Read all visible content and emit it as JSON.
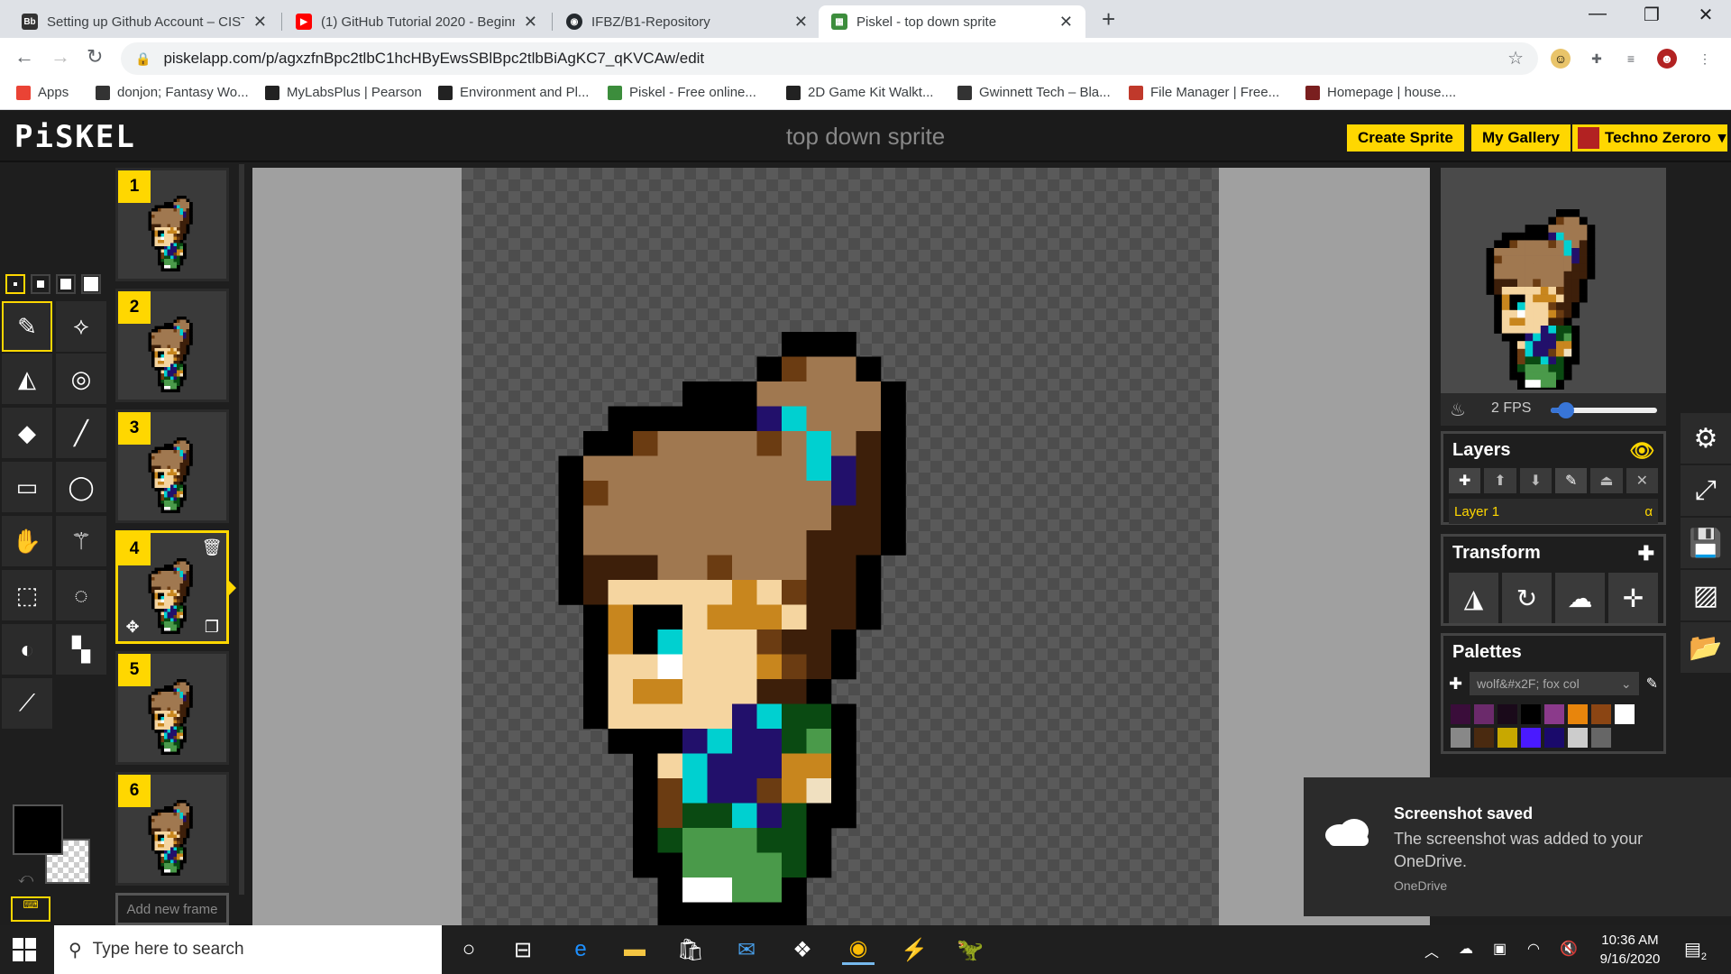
{
  "browser": {
    "tabs": [
      {
        "title": "Setting up Github Account – CIST",
        "favicon": "Bb",
        "color": "#333333"
      },
      {
        "title": "(1) GitHub Tutorial 2020 - Beginn",
        "favicon": "▶",
        "color": "#ff0000"
      },
      {
        "title": "IFBZ/B1-Repository",
        "favicon": "◉",
        "color": "#24292e"
      },
      {
        "title": "Piskel - top down sprite",
        "favicon": "▦",
        "color": "#3c8d3c"
      }
    ],
    "url": "piskelapp.com/p/agxzfnBpc2tlbC1hcHByEwsSBlBpc2tlbBiAgKC7_qKVCAw/edit",
    "bookmarks": [
      {
        "label": "Apps",
        "icon": "apps-icon",
        "color": "#ea4335"
      },
      {
        "label": "donjon; Fantasy Wo...",
        "icon": "donjon-icon",
        "color": "#333333"
      },
      {
        "label": "MyLabsPlus | Pearson",
        "icon": "pearson-icon",
        "color": "#222222"
      },
      {
        "label": "Environment and Pl...",
        "icon": "unity-icon",
        "color": "#222222"
      },
      {
        "label": "Piskel - Free online...",
        "icon": "piskel-icon",
        "color": "#3c8d3c"
      },
      {
        "label": "2D Game Kit Walkt...",
        "icon": "unity-icon",
        "color": "#222222"
      },
      {
        "label": "Gwinnett Tech – Bla...",
        "icon": "blackboard-icon",
        "color": "#333333"
      },
      {
        "label": "File Manager | Free...",
        "icon": "filemanager-icon",
        "color": "#c0392b"
      },
      {
        "label": "Homepage | house....",
        "icon": "house-icon",
        "color": "#7a1f1f"
      }
    ]
  },
  "piskel": {
    "logo": "PiSKEL",
    "title": "top down sprite",
    "create_sprite": "Create Sprite",
    "my_gallery": "My Gallery",
    "user": "Techno Zeroro",
    "frames": [
      "1",
      "2",
      "3",
      "4",
      "5",
      "6"
    ],
    "selected_frame": 4,
    "add_frame": "Add new frame",
    "fps_label": "2 FPS",
    "fps_value": 2,
    "fps_max": 24,
    "layers_title": "Layers",
    "layer_name": "Layer 1",
    "layer_alpha": "α",
    "transform_title": "Transform",
    "palettes_title": "Palettes",
    "palette_name": "wolf&#x2F; fox col",
    "palette_colors": [
      "#3a0d3a",
      "#6b2a6b",
      "#1a0a1a",
      "#000000",
      "#8b3a8b",
      "#e8850c",
      "#8b4513",
      "#ffffff",
      "#888888",
      "#4a2a10",
      "#c8a800",
      "#4a1aff",
      "#1a0a6b",
      "#cccccc",
      "#666666"
    ],
    "primary_color": "#000000"
  },
  "toast": {
    "title": "Screenshot saved",
    "body": "The screenshot was added to your OneDrive.",
    "source": "OneDrive"
  },
  "taskbar": {
    "search_placeholder": "Type here to search",
    "time": "10:36 AM",
    "date": "9/16/2020",
    "notification_count": "2"
  },
  "sprite": {
    "palette": {
      "K": "#000000",
      "H": "#a07850",
      "D": "#3d1f0a",
      "C": "#00d0d0",
      "P": "#22106b",
      "S": "#f5d5a0",
      "O": "#c8861e",
      "G": "#0a4a12",
      "L": "#4a9a4a",
      "W": "#ffffff",
      "B": "#6b3c12",
      "T": "#f0e0c0"
    },
    "rows": [
      "..........KKK.....",
      ".........KBHHK....",
      "......KKKHHHHHK...",
      "...KKKKKKPCHHHK...",
      "..KKBHHHHBHCHDK...",
      ".KHHHHHHHHHCPDK...",
      ".KBHHHHHHHHHPDK...",
      ".KHHHHHHHHHHDDK...",
      ".KHHHHHHHHHDDDK...",
      ".KDDDHHBHHHDDK....",
      ".KDSSSSSOSBDDK....",
      "..KOKKSOOOSDDK....",
      "..KOKCSSSBDDK.....",
      "..KSSWSSSOBDK.....",
      "..KSOOSSSDDK......",
      "..KSSSSSPCGGK.....",
      "...KKKPCPPGLK.....",
      "....KSCPPPOOK.....",
      "....KBCPPBOTK.....",
      "....KBGGCPGKK.....",
      "....KGLLLGGK......",
      "....KKLLLLGK......",
      ".....KWWLLK.......",
      ".....KKKKKK......."
    ]
  }
}
